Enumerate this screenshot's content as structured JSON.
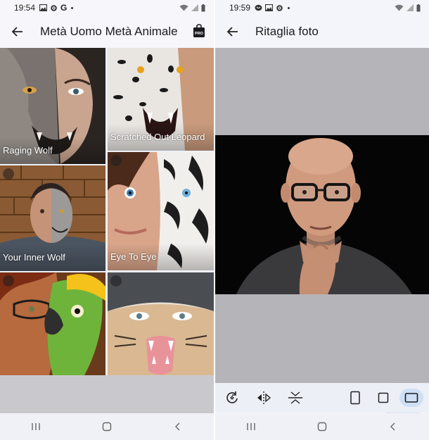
{
  "left_screen": {
    "status_bar": {
      "time": "19:54",
      "google_letter": "G"
    },
    "app_bar": {
      "title": "Metà Uomo Metà Animale"
    },
    "tiles": [
      {
        "label": "Raging Wolf",
        "has_badge": false
      },
      {
        "label": "Scratched Out Leopard",
        "has_badge": false
      },
      {
        "label": "Your Inner Wolf",
        "has_badge": true
      },
      {
        "label": "Eye To Eye",
        "has_badge": true
      },
      {
        "label": "",
        "has_badge": true
      },
      {
        "label": "",
        "has_badge": true
      }
    ]
  },
  "right_screen": {
    "status_bar": {
      "time": "19:59"
    },
    "app_bar": {
      "title": "Ritaglia foto"
    },
    "toolbar": {
      "selected_tool": "aspect-landscape",
      "tools": [
        "rotate-icon",
        "flip-horizontal-icon",
        "flip-vertical-icon",
        "aspect-portrait-icon",
        "aspect-square-icon",
        "aspect-landscape-icon"
      ]
    }
  },
  "colors": {
    "crop_background": "#b5b4b8",
    "fab_background": "#dde6f6",
    "toolbar_selected": "#cfe0f5",
    "toolbar_background": "#eceff6"
  }
}
